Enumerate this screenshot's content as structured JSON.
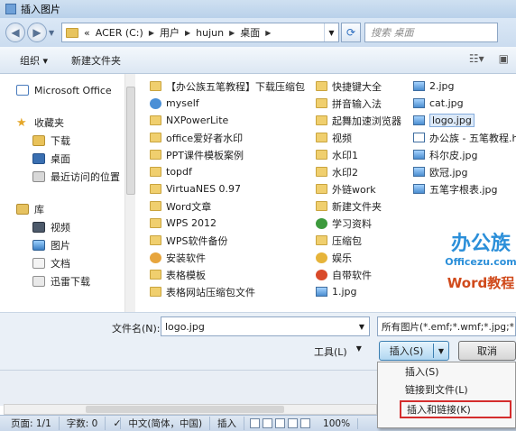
{
  "window": {
    "title": "插入图片"
  },
  "address": {
    "crumbs": [
      "«",
      "ACER (C:)",
      "用户",
      "hujun",
      "桌面"
    ],
    "search_placeholder": "搜索 桌面"
  },
  "toolbar": {
    "organize": "组织 ▾",
    "new_folder": "新建文件夹"
  },
  "nav": {
    "items": [
      {
        "label": "Microsoft Office",
        "icon": "office-icon",
        "top": true
      },
      {
        "label": "收藏夹",
        "icon": "star-icon",
        "top": true
      },
      {
        "label": "下载",
        "icon": "download-icon",
        "top": false
      },
      {
        "label": "桌面",
        "icon": "desktop-icon",
        "top": false
      },
      {
        "label": "最近访问的位置",
        "icon": "recent-places-icon",
        "top": false
      },
      {
        "label": "库",
        "icon": "library-icon",
        "top": true
      },
      {
        "label": "视频",
        "icon": "video-icon",
        "top": false
      },
      {
        "label": "图片",
        "icon": "picture-icon",
        "top": false
      },
      {
        "label": "文档",
        "icon": "document-icon",
        "top": false
      },
      {
        "label": "迅雷下载",
        "icon": "xunlei-icon",
        "top": false
      }
    ]
  },
  "files": {
    "col1": [
      {
        "name": "【办公族五笔教程】下载压缩包",
        "type": "folder"
      },
      {
        "name": "myself",
        "type": "folder"
      },
      {
        "name": "NXPowerLite",
        "type": "folder"
      },
      {
        "name": "office爱好者水印",
        "type": "folder"
      },
      {
        "name": "PPT课件模板案例",
        "type": "folder"
      },
      {
        "name": "topdf",
        "type": "folder"
      },
      {
        "name": "VirtuaNES 0.97",
        "type": "folder"
      },
      {
        "name": "Word文章",
        "type": "folder"
      },
      {
        "name": "WPS 2012",
        "type": "folder"
      },
      {
        "name": "WPS软件备份",
        "type": "folder"
      },
      {
        "name": "安装软件",
        "type": "folder"
      },
      {
        "name": "表格模板",
        "type": "folder"
      },
      {
        "name": "表格网站压缩包文件",
        "type": "folder"
      }
    ],
    "col2": [
      {
        "name": "快捷键大全",
        "type": "folder"
      },
      {
        "name": "拼音输入法",
        "type": "folder"
      },
      {
        "name": "起舞加速浏览器",
        "type": "folder"
      },
      {
        "name": "视频",
        "type": "folder"
      },
      {
        "name": "水印1",
        "type": "folder"
      },
      {
        "name": "水印2",
        "type": "folder"
      },
      {
        "name": "外链work",
        "type": "folder"
      },
      {
        "name": "新建文件夹",
        "type": "folder"
      },
      {
        "name": "学习资料",
        "type": "special"
      },
      {
        "name": "压缩包",
        "type": "folder"
      },
      {
        "name": "娱乐",
        "type": "special"
      },
      {
        "name": "自带软件",
        "type": "special"
      },
      {
        "name": "1.jpg",
        "type": "image"
      }
    ],
    "col3": [
      {
        "name": "2.jpg",
        "type": "image"
      },
      {
        "name": "cat.jpg",
        "type": "image"
      },
      {
        "name": "logo.jpg",
        "type": "image",
        "selected": true
      },
      {
        "name": "办公族 - 五笔教程.htm",
        "type": "image"
      },
      {
        "name": "科尔皮.jpg",
        "type": "image"
      },
      {
        "name": "欧冠.jpg",
        "type": "image"
      },
      {
        "name": "五笔字根表.jpg",
        "type": "image"
      }
    ]
  },
  "watermark": {
    "cn": "办公族",
    "en": "Officezu.com",
    "word": "Word教程"
  },
  "bottom": {
    "filename_label": "文件名(N):",
    "filename_value": "logo.jpg",
    "filetype_value": "所有图片(*.emf;*.wmf;*.jpg;*.jp",
    "tools_label": "工具(L)",
    "insert_label": "插入(S)",
    "cancel_label": "取消"
  },
  "menu": {
    "items": [
      "插入(S)",
      "链接到文件(L)",
      "插入和链接(K)"
    ]
  },
  "status": {
    "page": "页面: 1/1",
    "words": "字数: 0",
    "lang": "中文(简体，中国)",
    "mode": "插入",
    "zoom": "100%"
  },
  "colors": {
    "accent": "#2b8fd9",
    "highlight_border": "#d42d2d"
  }
}
